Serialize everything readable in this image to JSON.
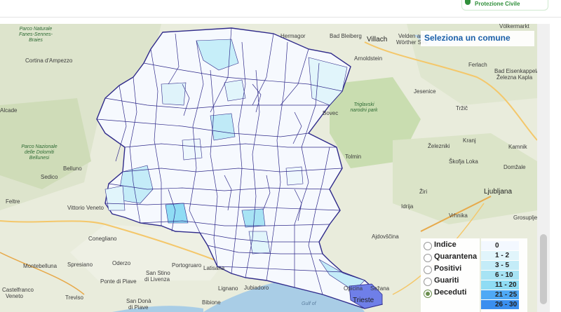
{
  "header": {
    "logo_text": "Protezione Civile"
  },
  "map": {
    "places": [
      {
        "text": "Hermagor",
        "cls": "place",
        "l": 400,
        "t": 47
      },
      {
        "text": "Bad Bleiberg",
        "cls": "place",
        "l": 470,
        "t": 47
      },
      {
        "text": "Villach",
        "cls": "place big",
        "l": 523,
        "t": 51
      },
      {
        "text": "Velden am",
        "cls": "place",
        "l": 568,
        "t": 47
      },
      {
        "text": "Wörther See",
        "cls": "place",
        "l": 565,
        "t": 56
      },
      {
        "text": "Völkermarkt",
        "cls": "place",
        "l": 712,
        "t": 33
      },
      {
        "text": "Arnoldstein",
        "cls": "place",
        "l": 505,
        "t": 79
      },
      {
        "text": "Ferlach",
        "cls": "place",
        "l": 668,
        "t": 88
      },
      {
        "text": "Bad Eisenkappel/",
        "cls": "place",
        "l": 705,
        "t": 97
      },
      {
        "text": "Železna Kapla",
        "cls": "place",
        "l": 708,
        "t": 106
      },
      {
        "text": "Jesenice",
        "cls": "place",
        "l": 590,
        "t": 126
      },
      {
        "text": "Tržič",
        "cls": "place",
        "l": 650,
        "t": 150
      },
      {
        "text": "Triglavski narodni park",
        "cls": "place park",
        "l": 494,
        "t": 146,
        "w": 50
      },
      {
        "text": "Bovec",
        "cls": "place",
        "l": 460,
        "t": 157
      },
      {
        "text": "Tolmin",
        "cls": "place",
        "l": 492,
        "t": 219
      },
      {
        "text": "Železniki",
        "cls": "place",
        "l": 610,
        "t": 204
      },
      {
        "text": "Kranj",
        "cls": "place",
        "l": 660,
        "t": 196
      },
      {
        "text": "Kamnik",
        "cls": "place",
        "l": 725,
        "t": 205
      },
      {
        "text": "Škofja Loka",
        "cls": "place",
        "l": 640,
        "t": 226
      },
      {
        "text": "Domžale",
        "cls": "place",
        "l": 718,
        "t": 234
      },
      {
        "text": "Žiri",
        "cls": "place",
        "l": 598,
        "t": 269
      },
      {
        "text": "Ljubljana",
        "cls": "place big",
        "l": 690,
        "t": 268
      },
      {
        "text": "Idrija",
        "cls": "place",
        "l": 572,
        "t": 290
      },
      {
        "text": "Vrhnika",
        "cls": "place",
        "l": 640,
        "t": 303
      },
      {
        "text": "Grosuplje",
        "cls": "place",
        "l": 732,
        "t": 306
      },
      {
        "text": "Ajdovščina",
        "cls": "place",
        "l": 530,
        "t": 333
      },
      {
        "text": "Cortina d'Ampezzo",
        "cls": "place",
        "l": 36,
        "t": 82
      },
      {
        "text": "Parco Naturale Fanes-Sennes-Braies",
        "cls": "place park",
        "l": 22,
        "t": 38,
        "w": 58
      },
      {
        "text": "Parco Nazionale delle Dolomiti Bellunesi",
        "cls": "place park",
        "l": 25,
        "t": 206,
        "w": 62
      },
      {
        "text": "Alcade",
        "cls": "place",
        "l": 0,
        "t": 153
      },
      {
        "text": "Sedico",
        "cls": "place",
        "l": 58,
        "t": 248
      },
      {
        "text": "Belluno",
        "cls": "place",
        "l": 90,
        "t": 236
      },
      {
        "text": "Feltre",
        "cls": "place",
        "l": 8,
        "t": 283
      },
      {
        "text": "Vittorio Veneto",
        "cls": "place",
        "l": 96,
        "t": 292
      },
      {
        "text": "Conegliano",
        "cls": "place",
        "l": 126,
        "t": 336
      },
      {
        "text": "Montebelluna",
        "cls": "place",
        "l": 33,
        "t": 375
      },
      {
        "text": "Spresiano",
        "cls": "place",
        "l": 96,
        "t": 373
      },
      {
        "text": "Oderzo",
        "cls": "place",
        "l": 160,
        "t": 371
      },
      {
        "text": "Castelfranco",
        "cls": "place",
        "l": 3,
        "t": 409
      },
      {
        "text": "Veneto",
        "cls": "place",
        "l": 8,
        "t": 418
      },
      {
        "text": "Treviso",
        "cls": "place",
        "l": 93,
        "t": 420
      },
      {
        "text": "Ponte di Piave",
        "cls": "place",
        "l": 143,
        "t": 397
      },
      {
        "text": "San Donà",
        "cls": "place",
        "l": 180,
        "t": 425
      },
      {
        "text": "di Piave",
        "cls": "place",
        "l": 183,
        "t": 434
      },
      {
        "text": "San Stino",
        "cls": "place",
        "l": 208,
        "t": 385
      },
      {
        "text": "di Livenza",
        "cls": "place",
        "l": 206,
        "t": 394
      },
      {
        "text": "Portogruaro",
        "cls": "place",
        "l": 245,
        "t": 374
      },
      {
        "text": "Latisana",
        "cls": "place",
        "l": 290,
        "t": 378
      },
      {
        "text": "Lignano",
        "cls": "place",
        "l": 311,
        "t": 407
      },
      {
        "text": "Bibione",
        "cls": "place",
        "l": 288,
        "t": 427
      },
      {
        "text": "Jubiadoro",
        "cls": "place",
        "l": 348,
        "t": 406
      },
      {
        "text": "Opicina",
        "cls": "place",
        "l": 490,
        "t": 407
      },
      {
        "text": "Sežana",
        "cls": "place",
        "l": 528,
        "t": 407
      },
      {
        "text": "Trieste",
        "cls": "place big",
        "l": 503,
        "t": 423
      },
      {
        "text": "Gulf of",
        "cls": "place sea",
        "l": 430,
        "t": 430
      }
    ],
    "select_label": "Seleziona un comune",
    "layers": [
      {
        "label": "Indice",
        "selected": false
      },
      {
        "label": "Quarantena",
        "selected": false
      },
      {
        "label": "Positivi",
        "selected": false
      },
      {
        "label": "Guariti",
        "selected": false
      },
      {
        "label": "Deceduti",
        "selected": true
      }
    ],
    "legend": [
      {
        "label": "0",
        "color": "#f3f8ff"
      },
      {
        "label": "1 - 2",
        "color": "#e1f5fb"
      },
      {
        "label": "3 - 5",
        "color": "#c4ecf8"
      },
      {
        "label": "6 - 10",
        "color": "#a7e3f4"
      },
      {
        "label": "11 - 20",
        "color": "#8fdcf4"
      },
      {
        "label": "21 - 25",
        "color": "#4fa9f5"
      },
      {
        "label": "26 - 30",
        "color": "#3a8fef"
      }
    ]
  }
}
